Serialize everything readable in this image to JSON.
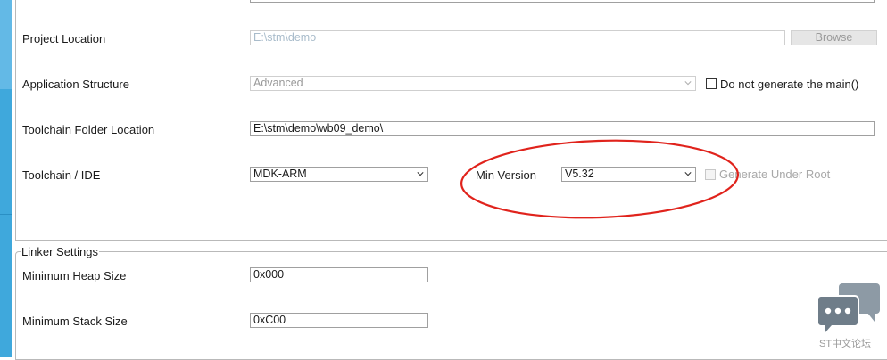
{
  "project_location": {
    "label": "Project Location",
    "value": "E:\\stm\\demo",
    "browse_label": "Browse"
  },
  "application_structure": {
    "label": "Application Structure",
    "value": "Advanced",
    "checkbox_label": "Do not generate the main()"
  },
  "toolchain_folder": {
    "label": "Toolchain Folder Location",
    "value": "E:\\stm\\demo\\wb09_demo\\"
  },
  "toolchain_ide": {
    "label": "Toolchain / IDE",
    "value": "MDK-ARM",
    "min_version_label": "Min Version",
    "min_version_value": "V5.32",
    "generate_root_label": "Generate Under Root"
  },
  "linker_settings": {
    "title": "Linker Settings",
    "heap_label": "Minimum Heap Size",
    "heap_value": "0x000",
    "stack_label": "Minimum Stack Size",
    "stack_value": "0xC00"
  },
  "watermark": {
    "text": "ST中文论坛",
    "icon": "chat-bubbles-icon"
  },
  "colors": {
    "sidebar": "#3fa8dc",
    "annotation_circle": "#e0231c"
  }
}
